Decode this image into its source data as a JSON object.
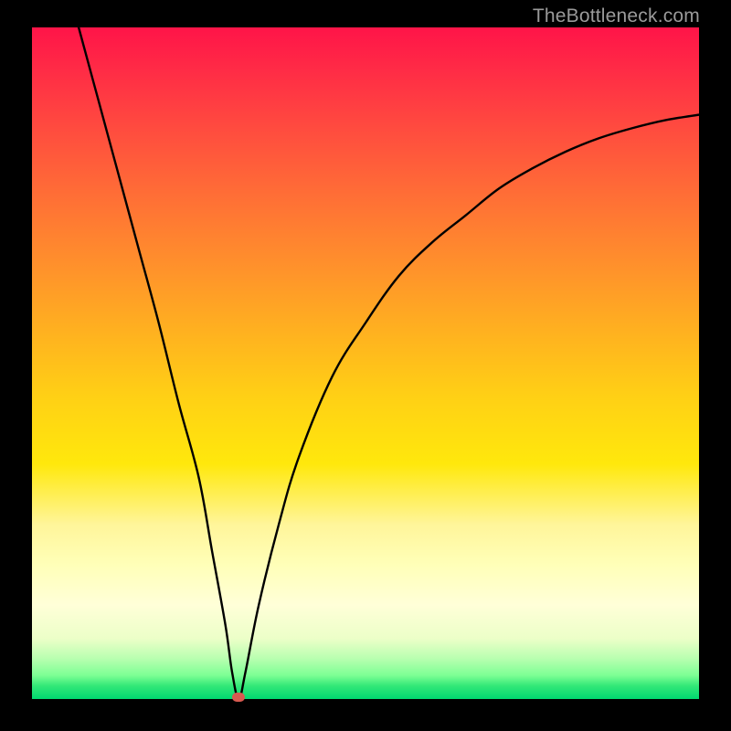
{
  "watermark": "TheBottleneck.com",
  "colors": {
    "frame": "#000000",
    "curve": "#000000",
    "marker": "#d85a50",
    "gradient_top": "#ff1448",
    "gradient_bottom": "#00d870"
  },
  "chart_data": {
    "type": "line",
    "title": "",
    "xlabel": "",
    "ylabel": "",
    "xlim": [
      0,
      100
    ],
    "ylim": [
      0,
      100
    ],
    "grid": false,
    "legend": false,
    "series": [
      {
        "name": "bottleneck-curve",
        "x": [
          7,
          10,
          13,
          16,
          19,
          22,
          25,
          27,
          29,
          30,
          31,
          32,
          34,
          37,
          40,
          45,
          50,
          55,
          60,
          65,
          70,
          75,
          80,
          85,
          90,
          95,
          100
        ],
        "values": [
          100,
          89,
          78,
          67,
          56,
          44,
          33,
          22,
          11,
          4,
          0,
          4,
          14,
          26,
          36,
          48,
          56,
          63,
          68,
          72,
          76,
          79,
          81.5,
          83.5,
          85,
          86.2,
          87
        ]
      }
    ],
    "annotations": [
      {
        "name": "minimum-marker",
        "x": 31,
        "y": 0
      }
    ]
  }
}
